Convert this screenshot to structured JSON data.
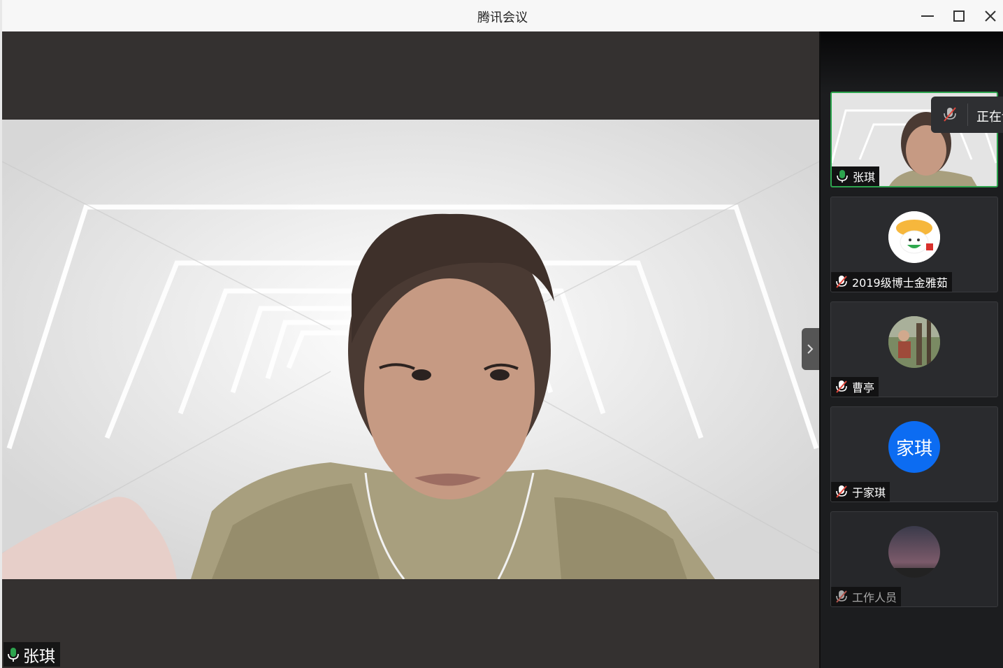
{
  "window": {
    "title": "腾讯会议",
    "controls": [
      "minimize-icon",
      "maximize-icon",
      "close-icon"
    ]
  },
  "main_video": {
    "speaker_name": "张琪",
    "mic_state": "on"
  },
  "sidebar": {
    "notice_text": "正在讲",
    "participants": [
      {
        "name": "张琪",
        "mic": "on",
        "video": "camera",
        "active": true
      },
      {
        "name": "2019级博士金雅茹",
        "mic": "muted",
        "video": "avatar-cartoon"
      },
      {
        "name": "曹亭",
        "mic": "muted",
        "video": "avatar-photo"
      },
      {
        "name": "于家琪",
        "mic": "muted",
        "video": "avatar-text",
        "avatar_text": "家琪",
        "avatar_color": "#0c6cf2"
      },
      {
        "name": "工作人员",
        "mic": "muted",
        "video": "avatar-sky",
        "dim": true
      }
    ]
  },
  "colors": {
    "mic_on": "#2da44e",
    "mic_muted": "#e0463b",
    "accent_blue": "#0c6cf2"
  }
}
